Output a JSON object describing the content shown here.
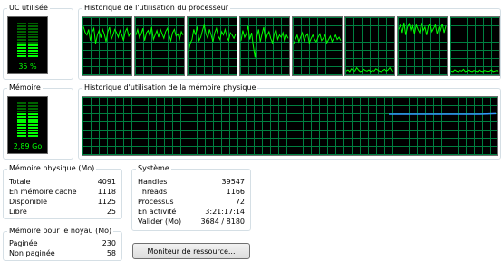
{
  "cpu": {
    "title": "UC utilisée",
    "value": "35 %",
    "fraction": 0.35,
    "history_title": "Historique de l'utilisation du processeur",
    "cores": [
      [
        0.85,
        0.75,
        0.7,
        0.8,
        0.6,
        0.75,
        0.82,
        0.55,
        0.7,
        0.78,
        0.65,
        0.8,
        0.72,
        0.58,
        0.76,
        0.84,
        0.62,
        0.7,
        0.8,
        0.74,
        0.66,
        0.78,
        0.7,
        0.6,
        0.76,
        0.82,
        0.68,
        0.74
      ],
      [
        0.7,
        0.8,
        0.65,
        0.72,
        0.82,
        0.6,
        0.74,
        0.78,
        0.68,
        0.84,
        0.62,
        0.7,
        0.78,
        0.66,
        0.8,
        0.72,
        0.64,
        0.76,
        0.82,
        0.7,
        0.6,
        0.74,
        0.8,
        0.68,
        0.72,
        0.62,
        0.76,
        0.7
      ],
      [
        0.4,
        0.55,
        0.62,
        0.8,
        0.7,
        0.85,
        0.6,
        0.66,
        0.78,
        0.88,
        0.72,
        0.64,
        0.8,
        0.7,
        0.58,
        0.74,
        0.82,
        0.68,
        0.62,
        0.76,
        0.7,
        0.8,
        0.66,
        0.6,
        0.74,
        0.7,
        0.64,
        0.72
      ],
      [
        0.6,
        0.78,
        0.66,
        0.72,
        0.86,
        0.62,
        0.74,
        0.5,
        0.3,
        0.66,
        0.8,
        0.58,
        0.72,
        0.84,
        0.6,
        0.7,
        0.76,
        0.64,
        0.56,
        0.72,
        0.8,
        0.62,
        0.7,
        0.66,
        0.74,
        0.58,
        0.7,
        0.64
      ],
      [
        0.55,
        0.62,
        0.7,
        0.58,
        0.66,
        0.74,
        0.6,
        0.68,
        0.72,
        0.56,
        0.64,
        0.7,
        0.62,
        0.58,
        0.66,
        0.72,
        0.6,
        0.64,
        0.7,
        0.56,
        0.62,
        0.68,
        0.58,
        0.64,
        0.7,
        0.62,
        0.66,
        0.6
      ],
      [
        0.06,
        0.08,
        0.05,
        0.1,
        0.07,
        0.06,
        0.12,
        0.08,
        0.05,
        0.06,
        0.09,
        0.07,
        0.06,
        0.08,
        0.05,
        0.07,
        0.06,
        0.1,
        0.08,
        0.06,
        0.05,
        0.07,
        0.09,
        0.06,
        0.08,
        0.12,
        0.07,
        0.06
      ],
      [
        0.8,
        0.88,
        0.74,
        0.92,
        0.7,
        0.84,
        0.9,
        0.76,
        0.86,
        0.72,
        0.88,
        0.8,
        0.74,
        0.92,
        0.78,
        0.84,
        0.7,
        0.86,
        0.9,
        0.76,
        0.82,
        0.88,
        0.72,
        0.84,
        0.78,
        0.9,
        0.74,
        0.86
      ],
      [
        0.06,
        0.05,
        0.08,
        0.06,
        0.05,
        0.07,
        0.06,
        0.09,
        0.05,
        0.06,
        0.08,
        0.06,
        0.05,
        0.07,
        0.06,
        0.05,
        0.08,
        0.06,
        0.05,
        0.07,
        0.06,
        0.05,
        0.06,
        0.08,
        0.05,
        0.06,
        0.07,
        0.05
      ]
    ]
  },
  "memory": {
    "title": "Mémoire",
    "value": "2,89 Go",
    "fraction": 0.71,
    "history_title": "Historique d'utilisation de la mémoire physique",
    "history": [
      0.71,
      0.71,
      0.71,
      0.71,
      0.71,
      0.71,
      0.71,
      0.72
    ]
  },
  "physical": {
    "title": "Mémoire physique (Mo)",
    "rows": [
      {
        "label": "Totale",
        "value": "4091"
      },
      {
        "label": "En mémoire cache",
        "value": "1118"
      },
      {
        "label": "Disponible",
        "value": "1125"
      },
      {
        "label": "Libre",
        "value": "25"
      }
    ]
  },
  "system": {
    "title": "Système",
    "rows": [
      {
        "label": "Handles",
        "value": "39547"
      },
      {
        "label": "Threads",
        "value": "1166"
      },
      {
        "label": "Processus",
        "value": "72"
      },
      {
        "label": "En activité",
        "value": "3:21:17:14"
      },
      {
        "label": "Valider (Mo)",
        "value": "3684 / 8180"
      }
    ]
  },
  "kernel": {
    "title": "Mémoire pour le noyau (Mo)",
    "rows": [
      {
        "label": "Paginée",
        "value": "230"
      },
      {
        "label": "Non paginée",
        "value": "58"
      }
    ]
  },
  "button": {
    "label": "Moniteur de ressource..."
  },
  "colors": {
    "grid": "#008040",
    "line": "#00ff00",
    "mem_line": "#3399ff",
    "bar_on": "#00ff00",
    "bar_off": "#006400"
  }
}
